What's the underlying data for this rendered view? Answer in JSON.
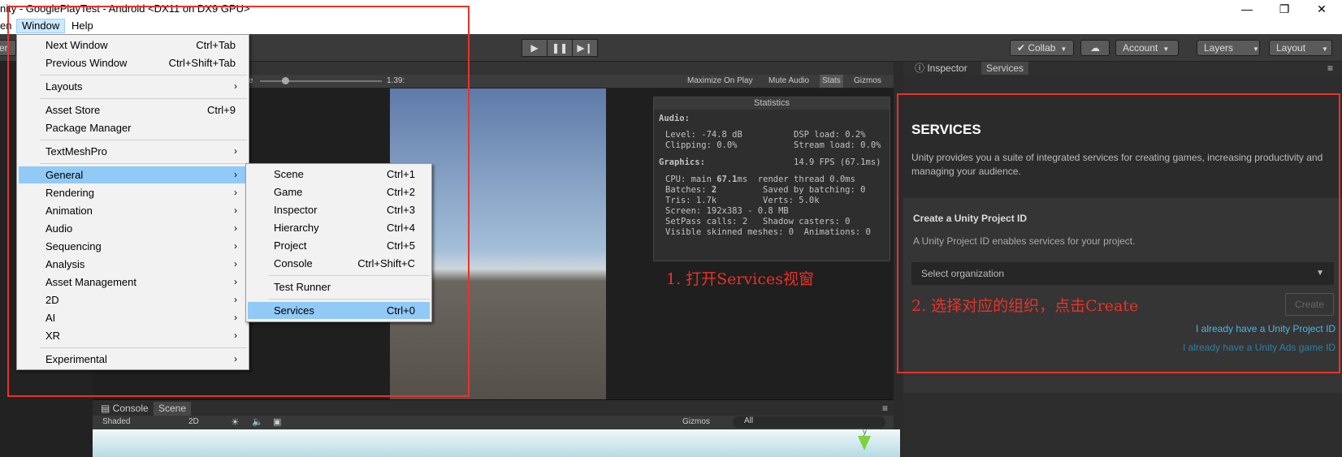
{
  "window": {
    "title": "nity - GooglePlayTest - Android <DX11 on DX9 GPU>",
    "minimize": "—",
    "maximize": "❐",
    "close": "✕"
  },
  "menubar": {
    "partial_left": "en",
    "window": "Window",
    "help": "Help"
  },
  "toolbar": {
    "left_partial": "er",
    "play": "▶",
    "pause": "❚❚",
    "step": "▶❙",
    "collab": "Collab",
    "account": "Account",
    "layers": "Layers",
    "layout": "Layout"
  },
  "game_toolbar": {
    "scale_partial": "e",
    "scale_value": "1.39:",
    "maximize_on_play": "Maximize On Play",
    "mute_audio": "Mute Audio",
    "stats": "Stats",
    "gizmos": "Gizmos"
  },
  "statistics": {
    "title": "Statistics",
    "audio_label": "Audio:",
    "level": "Level: -74.8 dB",
    "dsp_load": "DSP load: 0.2%",
    "clipping": "Clipping: 0.0%",
    "stream_load": "Stream load: 0.0%",
    "graphics_label": "Graphics:",
    "fps": "14.9 FPS (67.1ms)",
    "cpu_prefix": "CPU: main ",
    "cpu_main": "67.1",
    "cpu_suffix": "ms  render thread 0.0ms",
    "batches_prefix": "Batches: ",
    "batches": "2",
    "saved_by_batching": "Saved by batching: 0",
    "tris": "Tris: 1.7k",
    "verts": "Verts: 5.0k",
    "screen": "Screen: 192x383 - 0.8 MB",
    "setpass": "SetPass calls: 2",
    "shadow_casters": "Shadow casters: 0",
    "skinned": "Visible skinned meshes: 0  Animations: 0"
  },
  "annotations": {
    "step1": "1. 打开Services视窗",
    "step2": "2. 选择对应的组织，点击Create"
  },
  "window_menu": {
    "items": [
      {
        "label": "Next Window",
        "shortcut": "Ctrl+Tab"
      },
      {
        "label": "Previous Window",
        "shortcut": "Ctrl+Shift+Tab"
      },
      {
        "label": "Layouts",
        "arrow": "›"
      },
      {
        "label": "Asset Store",
        "shortcut": "Ctrl+9"
      },
      {
        "label": "Package Manager"
      },
      {
        "label": "TextMeshPro",
        "arrow": "›"
      },
      {
        "label": "General",
        "arrow": "›"
      },
      {
        "label": "Rendering",
        "arrow": "›"
      },
      {
        "label": "Animation",
        "arrow": "›"
      },
      {
        "label": "Audio",
        "arrow": "›"
      },
      {
        "label": "Sequencing",
        "arrow": "›"
      },
      {
        "label": "Analysis",
        "arrow": "›"
      },
      {
        "label": "Asset Management",
        "arrow": "›"
      },
      {
        "label": "2D",
        "arrow": "›"
      },
      {
        "label": "AI",
        "arrow": "›"
      },
      {
        "label": "XR",
        "arrow": "›"
      },
      {
        "label": "Experimental",
        "arrow": "›"
      }
    ]
  },
  "general_submenu": {
    "items": [
      {
        "label": "Scene",
        "shortcut": "Ctrl+1"
      },
      {
        "label": "Game",
        "shortcut": "Ctrl+2"
      },
      {
        "label": "Inspector",
        "shortcut": "Ctrl+3"
      },
      {
        "label": "Hierarchy",
        "shortcut": "Ctrl+4"
      },
      {
        "label": "Project",
        "shortcut": "Ctrl+5"
      },
      {
        "label": "Console",
        "shortcut": "Ctrl+Shift+C"
      },
      {
        "label": "Test Runner"
      },
      {
        "label": "Services",
        "shortcut": "Ctrl+0"
      }
    ]
  },
  "right_tabs": {
    "inspector": "Inspector",
    "services": "Services"
  },
  "services": {
    "title": "SERVICES",
    "description": "Unity provides you a suite of integrated services for creating games, increasing productivity and managing your audience.",
    "create_title": "Create a Unity Project ID",
    "create_desc": "A Unity Project ID enables services for your project.",
    "select_placeholder": "Select organization",
    "create_button": "Create",
    "link_project_id": "I already have a Unity Project ID",
    "link_ads_id": "I already have a Unity Ads game ID",
    "link_color": "#4ab8e8",
    "link_ads_color": "#2e7fa3"
  },
  "bottom": {
    "console_tab": "Console",
    "scene_tab": "Scene",
    "shaded": "Shaded",
    "two_d": "2D",
    "gizmos": "Gizmos",
    "search_placeholder": "All",
    "axis_y": "y"
  },
  "colors": {
    "annotation_red": "#e8332a",
    "menu_highlight": "#91c9f7"
  }
}
